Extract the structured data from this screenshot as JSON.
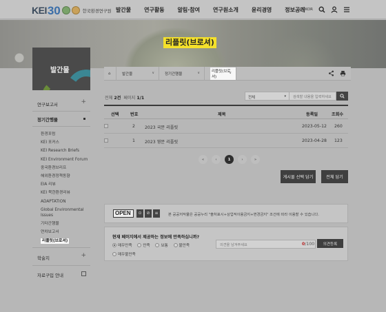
{
  "header": {
    "logo_kei": "KEI",
    "logo_30": "30",
    "logo_name": "한국환경연구원",
    "nav": [
      "발간물",
      "연구활동",
      "알림·참여",
      "연구원소개",
      "윤리경영",
      "정보공개"
    ],
    "lang": "KOR",
    "icons": [
      "globe-icon",
      "search-icon",
      "user-icon",
      "menu-icon"
    ]
  },
  "banner": {
    "title": "리플릿(브로셔)"
  },
  "sidebar": {
    "title": "발간물",
    "groups": [
      {
        "label": "연구보고서",
        "mark": "+"
      },
      {
        "label": "정기간행물",
        "mark": "•"
      }
    ],
    "sub_items": [
      "환경포럼",
      "KEI 포커스",
      "KEI Research Briefs",
      "KEI Environment Forum",
      "중국환경브리프",
      "해외환경정책동향",
      "EIA 리뷰",
      "KEI 북한환경리뷰",
      "ADAPTATION",
      "Global Environmental",
      "Issues",
      "기타간행물",
      "연차보고서",
      "리플릿(브로셔)"
    ],
    "bottom": [
      {
        "label": "학술지",
        "mark": "+"
      },
      {
        "label": "자료구입 안내"
      }
    ]
  },
  "breadcrumb": {
    "home": "⌂",
    "c1": "발간물",
    "c2": "정기간행물",
    "c3": "리플릿(브로셔)"
  },
  "toolbar": {
    "total_label": "전체",
    "total_value": "2건",
    "page_label": "페이지",
    "page_value": "1/1",
    "select_value": "전체",
    "search_placeholder": "검색할 내용을 입력하세요"
  },
  "table": {
    "headers": [
      "선택",
      "번호",
      "제목",
      "등록일",
      "조회수"
    ],
    "rows": [
      {
        "num": "2",
        "title": "2023 국문 리플릿",
        "date": "2023-05-12",
        "views": "260"
      },
      {
        "num": "1",
        "title": "2023 영문 리플릿",
        "date": "2023-04-28",
        "views": "123"
      }
    ]
  },
  "pager": {
    "first": "«",
    "prev": "‹",
    "current": "1",
    "next": "›",
    "last": "»"
  },
  "buttons": {
    "select_download": "게시물 선택 담기",
    "all_download": "전체 담기"
  },
  "license": {
    "logo": "OPEN",
    "text": "본 공공저작물은 공공누리 \"출처표시+상업적이용금지+변경금지\" 조건에 따라 이용할 수 있습니다."
  },
  "survey": {
    "question": "현재 페이지에서 제공하는 정보에 만족하십니까?",
    "options": [
      "매우만족",
      "만족",
      "보통",
      "불만족"
    ],
    "option5": "매우불만족",
    "opinion_placeholder": "의견을 남겨주세요",
    "count_current": "0",
    "count_max": "/100",
    "submit": "의견등록"
  }
}
